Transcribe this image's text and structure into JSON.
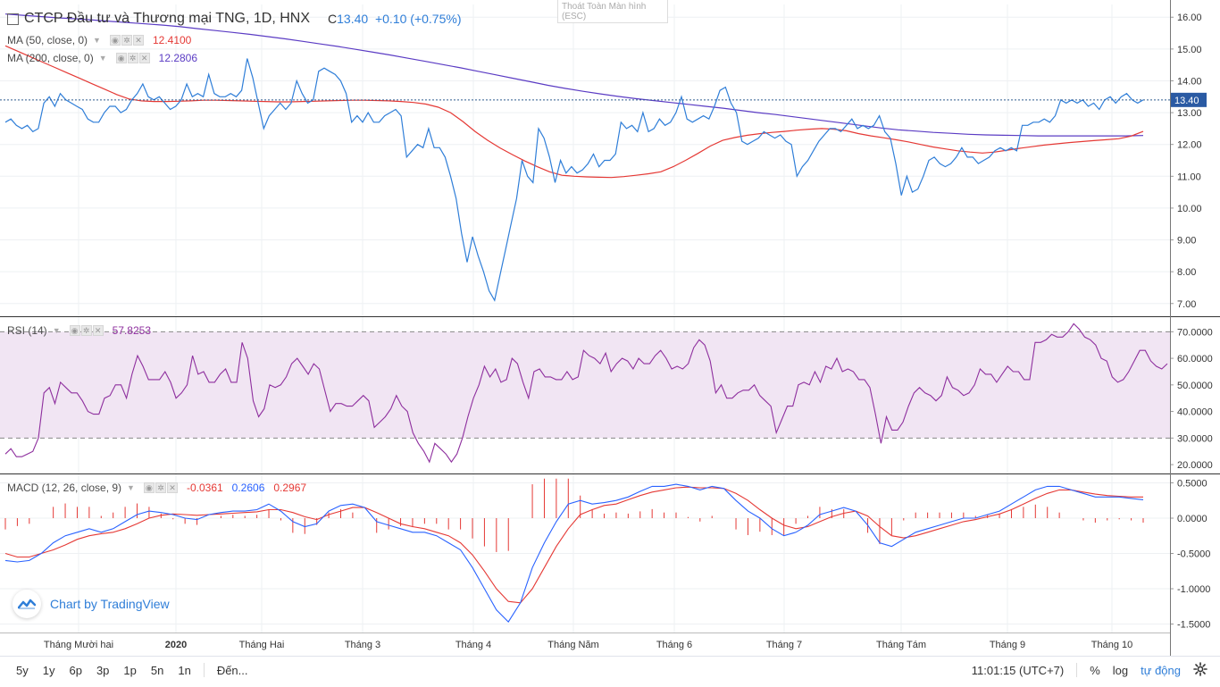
{
  "header": {
    "symbol_title": "CTCP Đầu tư và Thương mại TNG, 1D, HNX",
    "quote_prefix": "C",
    "quote_price": "13.40",
    "quote_change": "+0.10 (+0.75%)",
    "esc_hint": "Thoát Toàn Màn hình (ESC)"
  },
  "legends": {
    "ma50": {
      "label": "MA (50, close, 0)",
      "value": "12.4100",
      "color": "#e53935"
    },
    "ma200": {
      "label": "MA (200, close, 0)",
      "value": "12.2806",
      "color": "#5b3cc4"
    },
    "rsi": {
      "label": "RSI (14)",
      "value": "57.8253",
      "color": "#8e2f9e"
    },
    "macd": {
      "label": "MACD (12, 26, close, 9)",
      "value_hist": "-0.0361",
      "value_macd": "0.2606",
      "value_signal": "0.2967"
    }
  },
  "brand": {
    "text": "Chart by TradingView"
  },
  "toolbar": {
    "ranges": [
      "5y",
      "1y",
      "6p",
      "3p",
      "1p",
      "5n",
      "1n"
    ],
    "goto": "Đến...",
    "time": "11:01:15 (UTC+7)",
    "percent": "%",
    "log": "log",
    "auto": "tự động"
  },
  "colors": {
    "price": "#2f7ed8",
    "ma50": "#e53935",
    "ma200": "#5b3cc4",
    "rsi": "#8e2f9e",
    "macd": "#2962ff",
    "signal": "#e53935",
    "hist": "#e53935",
    "rsi_band": "#f1e5f3"
  },
  "chart_data": [
    {
      "type": "line",
      "pane": "price",
      "x_labels": [
        "Tháng Mười hai",
        "2020",
        "Tháng Hai",
        "Tháng 3",
        "Tháng 4",
        "Tháng Năm",
        "Tháng 6",
        "Tháng 7",
        "Tháng Tám",
        "Tháng 9",
        "Tháng 10"
      ],
      "y_ticks": [
        "16.00",
        "15.00",
        "14.00",
        "13.00",
        "12.00",
        "11.00",
        "10.00",
        "9.00",
        "8.00",
        "7.00"
      ],
      "ylim": [
        6.6,
        16.4
      ],
      "last_price_label": "13.40",
      "series": [
        {
          "name": "close",
          "values": [
            12.7,
            12.8,
            12.6,
            12.5,
            12.6,
            12.4,
            12.5,
            13.3,
            13.5,
            13.2,
            13.6,
            13.4,
            13.3,
            13.2,
            13.1,
            12.8,
            12.7,
            12.7,
            13.0,
            13.2,
            13.2,
            13.0,
            13.1,
            13.4,
            13.6,
            13.9,
            13.5,
            13.4,
            13.5,
            13.3,
            13.1,
            13.2,
            13.4,
            13.9,
            13.5,
            13.6,
            13.5,
            14.2,
            13.6,
            13.5,
            13.5,
            13.6,
            13.5,
            13.7,
            14.7,
            14.1,
            13.3,
            12.5,
            12.9,
            13.1,
            13.3,
            13.1,
            13.3,
            14.0,
            13.6,
            13.3,
            13.4,
            14.3,
            14.4,
            14.3,
            14.2,
            14.0,
            13.6,
            12.7,
            12.9,
            12.7,
            13.0,
            12.7,
            12.7,
            12.9,
            13.0,
            13.1,
            12.9,
            11.6,
            11.8,
            12.0,
            11.9,
            12.5,
            11.9,
            11.9,
            11.6,
            11.0,
            10.3,
            9.2,
            8.3,
            9.1,
            8.5,
            8.0,
            7.4,
            7.1,
            7.9,
            8.7,
            9.5,
            10.3,
            11.5,
            11.0,
            10.8,
            12.5,
            12.2,
            11.6,
            10.8,
            11.5,
            11.1,
            11.3,
            11.1,
            11.2,
            11.4,
            11.7,
            11.3,
            11.5,
            11.5,
            11.7,
            12.7,
            12.5,
            12.6,
            12.4,
            13.0,
            12.4,
            12.5,
            12.8,
            12.6,
            12.7,
            13.0,
            13.5,
            12.8,
            12.7,
            12.8,
            12.9,
            12.8,
            13.2,
            13.7,
            13.8,
            13.3,
            13.0,
            12.1,
            12.0,
            12.1,
            12.2,
            12.4,
            12.3,
            12.2,
            12.3,
            12.1,
            12.0,
            11.0,
            11.3,
            11.5,
            11.8,
            12.1,
            12.3,
            12.5,
            12.5,
            12.4,
            12.6,
            12.8,
            12.5,
            12.6,
            12.5,
            12.6,
            12.9,
            12.4,
            12.2,
            11.4,
            10.4,
            11.0,
            10.5,
            10.6,
            11.0,
            11.5,
            11.6,
            11.4,
            11.3,
            11.4,
            11.6,
            11.9,
            11.6,
            11.6,
            11.4,
            11.5,
            11.6,
            11.8,
            11.9,
            11.8,
            11.9,
            11.8,
            12.6,
            12.6,
            12.7,
            12.7,
            12.8,
            12.7,
            12.9,
            13.4,
            13.3,
            13.4,
            13.3,
            13.4,
            13.2,
            13.3,
            13.1,
            13.4,
            13.5,
            13.3,
            13.5,
            13.6,
            13.4,
            13.3,
            13.4
          ]
        },
        {
          "name": "MA (50, close, 0)",
          "values": [
            15.1,
            14.93,
            14.76,
            14.59,
            14.42,
            14.25,
            14.08,
            13.91,
            13.74,
            13.57,
            13.43,
            13.37,
            13.35,
            13.35,
            13.36,
            13.37,
            13.39,
            13.39,
            13.38,
            13.37,
            13.36,
            13.35,
            13.34,
            13.34,
            13.35,
            13.36,
            13.37,
            13.38,
            13.39,
            13.39,
            13.38,
            13.37,
            13.35,
            13.32,
            13.27,
            13.17,
            13.0,
            12.72,
            12.4,
            12.13,
            11.89,
            11.68,
            11.48,
            11.3,
            11.14,
            11.03,
            11.0,
            10.98,
            10.97,
            10.96,
            10.99,
            11.03,
            11.08,
            11.14,
            11.3,
            11.5,
            11.72,
            11.95,
            12.13,
            12.22,
            12.29,
            12.34,
            12.38,
            12.41,
            12.45,
            12.48,
            12.5,
            12.48,
            12.43,
            12.34,
            12.27,
            12.21,
            12.15,
            12.08,
            12.0,
            11.92,
            11.86,
            11.8,
            11.76,
            11.73,
            11.76,
            11.82,
            11.88,
            11.93,
            11.98,
            12.02,
            12.06,
            12.09,
            12.12,
            12.15,
            12.18,
            12.26,
            12.41
          ]
        },
        {
          "name": "MA (200, close, 0)",
          "values": [
            16.1,
            16.06,
            16.02,
            15.98,
            15.95,
            15.91,
            15.87,
            15.83,
            15.79,
            15.75,
            15.7,
            15.64,
            15.58,
            15.52,
            15.46,
            15.39,
            15.32,
            15.24,
            15.16,
            15.08,
            14.99,
            14.9,
            14.81,
            14.71,
            14.61,
            14.51,
            14.41,
            14.3,
            14.19,
            14.08,
            13.97,
            13.86,
            13.76,
            13.67,
            13.59,
            13.51,
            13.44,
            13.38,
            13.32,
            13.26,
            13.2,
            13.14,
            13.07,
            13.0,
            12.94,
            12.87,
            12.8,
            12.73,
            12.66,
            12.59,
            12.52,
            12.46,
            12.42,
            12.38,
            12.35,
            12.32,
            12.3,
            12.29,
            12.28,
            12.27,
            12.27,
            12.27,
            12.27,
            12.27,
            12.27,
            12.28
          ]
        }
      ]
    },
    {
      "type": "line",
      "pane": "rsi",
      "y_ticks": [
        "70.0000",
        "60.0000",
        "50.0000",
        "40.0000",
        "30.0000",
        "20.0000"
      ],
      "ylim": [
        17,
        75.5
      ],
      "band": [
        30,
        70
      ],
      "series": [
        {
          "name": "RSI (14)",
          "values": [
            24,
            26,
            23,
            23,
            24,
            25,
            30,
            47,
            49,
            43,
            51,
            49,
            47,
            47,
            44,
            40,
            39,
            39,
            45,
            46,
            50,
            50,
            45,
            54,
            61,
            57,
            52,
            52,
            52,
            55,
            51,
            45,
            47,
            50,
            61,
            54,
            55,
            51,
            51,
            54,
            56,
            51,
            51,
            66,
            60,
            44,
            38,
            41,
            50,
            49,
            50,
            53,
            58,
            60,
            57,
            54,
            58,
            56,
            48,
            40,
            43,
            43,
            42,
            42,
            44,
            46,
            44,
            34,
            36,
            38,
            41,
            46,
            42,
            40,
            32,
            28,
            25,
            21,
            28,
            26,
            24,
            21,
            24,
            30,
            38,
            45,
            50,
            57,
            53,
            56,
            51,
            52,
            60,
            58,
            51,
            45,
            55,
            56,
            53,
            53,
            52,
            52,
            55,
            52,
            53,
            63,
            61,
            60,
            58,
            62,
            55,
            58,
            60,
            59,
            56,
            60,
            58,
            58,
            61,
            63,
            60,
            56,
            57,
            56,
            58,
            64,
            67,
            65,
            59,
            47,
            50,
            45,
            45,
            47,
            48,
            48,
            50,
            46,
            44,
            42,
            32,
            37,
            42,
            42,
            50,
            51,
            50,
            55,
            51,
            57,
            56,
            60,
            55,
            56,
            55,
            52,
            52,
            49,
            39,
            28,
            38,
            33,
            33,
            36,
            42,
            47,
            49,
            47,
            46,
            44,
            46,
            53,
            49,
            48,
            46,
            47,
            50,
            56,
            54,
            54,
            51,
            54,
            57,
            55,
            55,
            52,
            52,
            66,
            66,
            67,
            69,
            68,
            68,
            70,
            73,
            71,
            68,
            67,
            65,
            60,
            59,
            53,
            51,
            52,
            55,
            59,
            63,
            63,
            59,
            57,
            56,
            58
          ]
        }
      ]
    },
    {
      "type": "line",
      "pane": "macd",
      "y_ticks": [
        "0.5000",
        "0.0000",
        "-0.5000",
        "-1.0000",
        "-1.5000"
      ],
      "ylim": [
        -1.62,
        0.62
      ],
      "series": [
        {
          "name": "MACD",
          "values": [
            -0.6,
            -0.62,
            -0.6,
            -0.5,
            -0.35,
            -0.25,
            -0.2,
            -0.15,
            -0.2,
            -0.15,
            -0.05,
            0.05,
            0.1,
            0.08,
            0.05,
            0.0,
            -0.02,
            0.05,
            0.08,
            0.1,
            0.1,
            0.12,
            0.2,
            0.1,
            -0.05,
            -0.12,
            -0.08,
            0.1,
            0.18,
            0.2,
            0.15,
            -0.05,
            -0.1,
            -0.15,
            -0.2,
            -0.2,
            -0.25,
            -0.35,
            -0.45,
            -0.7,
            -1.0,
            -1.3,
            -1.47,
            -1.2,
            -0.7,
            -0.35,
            -0.05,
            0.2,
            0.25,
            0.2,
            0.22,
            0.25,
            0.3,
            0.38,
            0.45,
            0.45,
            0.48,
            0.45,
            0.4,
            0.45,
            0.42,
            0.25,
            0.1,
            0.0,
            -0.15,
            -0.25,
            -0.2,
            -0.1,
            0.05,
            0.1,
            0.15,
            0.1,
            -0.1,
            -0.35,
            -0.4,
            -0.3,
            -0.2,
            -0.15,
            -0.1,
            -0.05,
            0.0,
            0.0,
            0.05,
            0.1,
            0.2,
            0.3,
            0.4,
            0.45,
            0.45,
            0.4,
            0.35,
            0.3,
            0.3,
            0.3,
            0.28,
            0.26
          ]
        },
        {
          "name": "Signal",
          "values": [
            -0.5,
            -0.55,
            -0.55,
            -0.5,
            -0.45,
            -0.38,
            -0.3,
            -0.25,
            -0.22,
            -0.2,
            -0.15,
            -0.08,
            0.0,
            0.04,
            0.06,
            0.05,
            0.04,
            0.05,
            0.06,
            0.07,
            0.08,
            0.09,
            0.12,
            0.12,
            0.08,
            0.02,
            -0.02,
            0.05,
            0.1,
            0.15,
            0.15,
            0.08,
            0.0,
            -0.08,
            -0.12,
            -0.15,
            -0.2,
            -0.25,
            -0.35,
            -0.52,
            -0.75,
            -1.0,
            -1.18,
            -1.2,
            -1.0,
            -0.7,
            -0.4,
            -0.15,
            0.05,
            0.12,
            0.18,
            0.2,
            0.26,
            0.32,
            0.37,
            0.4,
            0.43,
            0.44,
            0.43,
            0.43,
            0.42,
            0.35,
            0.25,
            0.12,
            0.0,
            -0.1,
            -0.15,
            -0.12,
            -0.05,
            0.02,
            0.07,
            0.1,
            0.03,
            -0.12,
            -0.25,
            -0.28,
            -0.25,
            -0.2,
            -0.15,
            -0.1,
            -0.05,
            -0.02,
            0.02,
            0.06,
            0.12,
            0.2,
            0.28,
            0.35,
            0.4,
            0.4,
            0.37,
            0.34,
            0.32,
            0.31,
            0.3,
            0.3
          ]
        }
      ]
    }
  ]
}
